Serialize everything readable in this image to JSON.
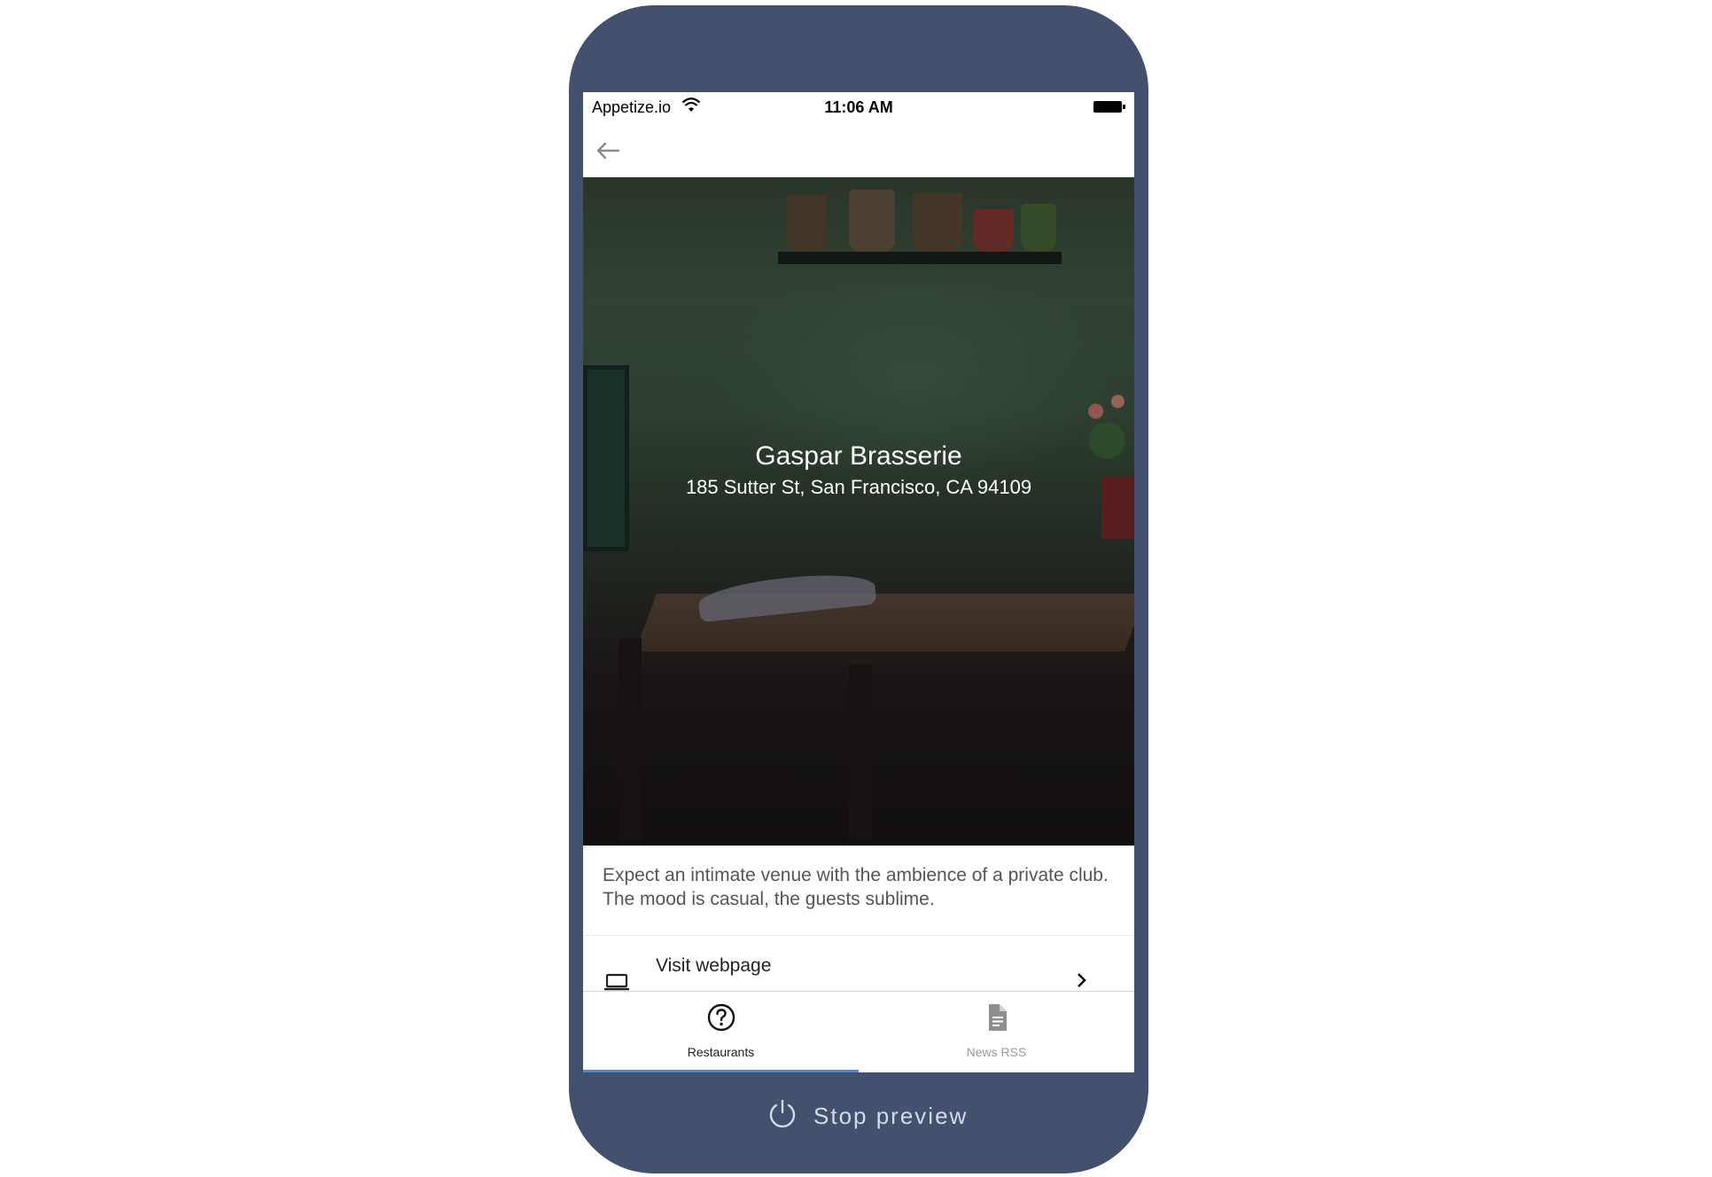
{
  "status_bar": {
    "carrier": "Appetize.io",
    "time": "11:06 AM"
  },
  "restaurant": {
    "name": "Gaspar Brasserie",
    "address": "185 Sutter St, San Francisco, CA 94109",
    "description": "Expect an intimate venue with the ambience of a private club. The mood is casual, the guests sublime."
  },
  "links": {
    "webpage_label": "Visit webpage"
  },
  "tabs": [
    {
      "label": "Restaurants",
      "icon": "help-circle-icon",
      "active": true
    },
    {
      "label": "News RSS",
      "icon": "document-icon",
      "active": false
    }
  ],
  "preview": {
    "stop_label": "Stop preview"
  },
  "colors": {
    "device_frame": "#43506e",
    "tab_indicator": "#4a86d8",
    "active_tab_text": "#222222",
    "inactive_tab_text": "#9a9a9a"
  }
}
